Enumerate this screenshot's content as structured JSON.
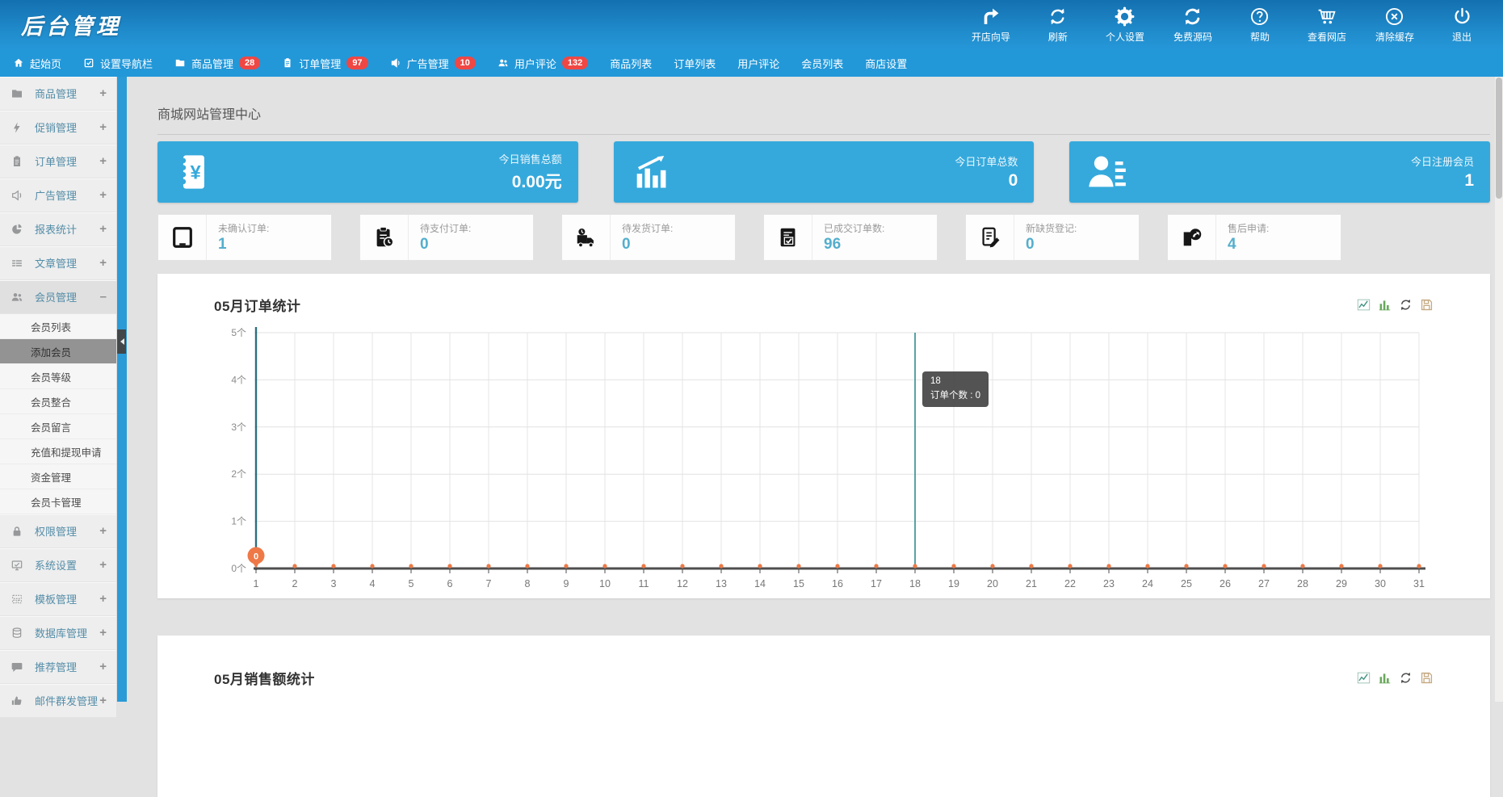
{
  "colors": {
    "header_blue_top": "#1470b0",
    "header_blue_bottom": "#2597d8",
    "navbar_blue": "#2298d9",
    "card_blue": "#35a9dc",
    "badge_red": "#ef4744",
    "stat_number_teal": "#54aecd",
    "chart_point_orange": "#ee7947",
    "crosshair_teal": "#2e8e8e"
  },
  "header": {
    "title": "后台管理",
    "actions": [
      {
        "label": "开店向导",
        "icon": "turn-right-icon"
      },
      {
        "label": "刷新",
        "icon": "refresh-icon"
      },
      {
        "label": "个人设置",
        "icon": "gear-icon"
      },
      {
        "label": "免费源码",
        "icon": "sync-icon"
      },
      {
        "label": "帮助",
        "icon": "question-circle-icon"
      },
      {
        "label": "查看网店",
        "icon": "cart-icon"
      },
      {
        "label": "清除缓存",
        "icon": "x-circle-icon"
      },
      {
        "label": "退出",
        "icon": "power-icon"
      }
    ]
  },
  "navbar": {
    "items": [
      {
        "label": "起始页",
        "icon": "home-icon"
      },
      {
        "label": "设置导航栏",
        "icon": "checkbox-icon"
      },
      {
        "label": "商品管理",
        "icon": "folder-icon",
        "badge": "28"
      },
      {
        "label": "订单管理",
        "icon": "clipboard-icon",
        "badge": "97"
      },
      {
        "label": "广告管理",
        "icon": "megaphone-icon",
        "badge": "10"
      },
      {
        "label": "用户评论",
        "icon": "users-icon",
        "badge": "132"
      },
      {
        "label": "商品列表"
      },
      {
        "label": "订单列表"
      },
      {
        "label": "用户评论"
      },
      {
        "label": "会员列表"
      },
      {
        "label": "商店设置"
      }
    ]
  },
  "sidebar": {
    "items": [
      {
        "label": "商品管理",
        "marker": "+",
        "icon": "folder-icon"
      },
      {
        "label": "促销管理",
        "marker": "+",
        "icon": "bolt-icon"
      },
      {
        "label": "订单管理",
        "marker": "+",
        "icon": "clipboard-icon"
      },
      {
        "label": "广告管理",
        "marker": "+",
        "icon": "megaphone-icon"
      },
      {
        "label": "报表统计",
        "marker": "+",
        "icon": "pie-chart-icon"
      },
      {
        "label": "文章管理",
        "marker": "+",
        "icon": "list-icon"
      },
      {
        "label": "会员管理",
        "marker": "–",
        "icon": "users-icon",
        "expanded": true,
        "children": [
          {
            "label": "会员列表"
          },
          {
            "label": "添加会员",
            "active": true
          },
          {
            "label": "会员等级"
          },
          {
            "label": "会员整合"
          },
          {
            "label": "会员留言"
          },
          {
            "label": "充值和提现申请"
          },
          {
            "label": "资金管理"
          },
          {
            "label": "会员卡管理"
          }
        ]
      },
      {
        "label": "权限管理",
        "marker": "+",
        "icon": "lock-icon"
      },
      {
        "label": "系统设置",
        "marker": "+",
        "icon": "monitor-icon"
      },
      {
        "label": "模板管理",
        "marker": "+",
        "icon": "template-icon"
      },
      {
        "label": "数据库管理",
        "marker": "+",
        "icon": "database-icon"
      },
      {
        "label": "推荐管理",
        "marker": "+",
        "icon": "comment-icon"
      },
      {
        "label": "邮件群发管理",
        "marker": "+",
        "icon": "thumb-icon"
      }
    ]
  },
  "main": {
    "page_title": "商城网站管理中心",
    "summary_cards": [
      {
        "label": "今日销售总额",
        "value": "0.00元",
        "icon": "money-icon"
      },
      {
        "label": "今日订单总数",
        "value": "0",
        "icon": "chart-up-icon"
      },
      {
        "label": "今日注册会员",
        "value": "1",
        "icon": "member-icon"
      }
    ],
    "stat_boxes": [
      {
        "label": "未确认订单:",
        "value": "1",
        "icon": "tablet-icon"
      },
      {
        "label": "待支付订单:",
        "value": "0",
        "icon": "clipboard-clock-icon"
      },
      {
        "label": "待发货订单:",
        "value": "0",
        "icon": "truck-icon"
      },
      {
        "label": "已成交订单数:",
        "value": "96",
        "icon": "clipboard-check-icon"
      },
      {
        "label": "新缺货登记:",
        "value": "0",
        "icon": "doc-pencil-icon"
      },
      {
        "label": "售后申请:",
        "value": "4",
        "icon": "return-arrow-icon"
      }
    ],
    "panels": [
      {
        "title": "05月订单统计"
      },
      {
        "title": "05月销售额统计"
      }
    ]
  },
  "chart_data": {
    "type": "line",
    "title": "05月订单统计",
    "x": [
      1,
      2,
      3,
      4,
      5,
      6,
      7,
      8,
      9,
      10,
      11,
      12,
      13,
      14,
      15,
      16,
      17,
      18,
      19,
      20,
      21,
      22,
      23,
      24,
      25,
      26,
      27,
      28,
      29,
      30,
      31
    ],
    "series": [
      {
        "name": "订单个数",
        "values": [
          0,
          0,
          0,
          0,
          0,
          0,
          0,
          0,
          0,
          0,
          0,
          0,
          0,
          0,
          0,
          0,
          0,
          0,
          0,
          0,
          0,
          0,
          0,
          0,
          0,
          0,
          0,
          0,
          0,
          0,
          0
        ]
      }
    ],
    "ylim": [
      0,
      5
    ],
    "ytick_labels": [
      "0个",
      "1个",
      "2个",
      "3个",
      "4个",
      "5个"
    ],
    "grid": true,
    "point_color": "#ee7947",
    "first_point_label": "0",
    "hover": {
      "x": 18,
      "title": "18",
      "text": "订单个数 : 0"
    }
  }
}
